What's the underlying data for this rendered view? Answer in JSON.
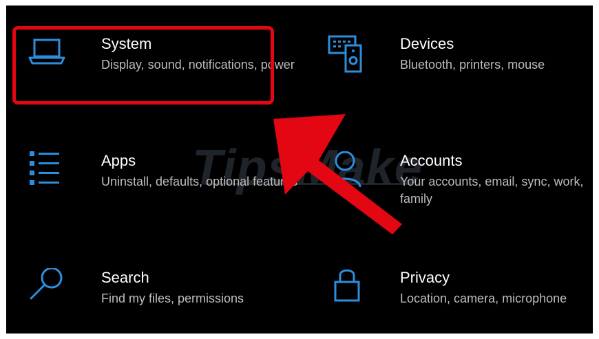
{
  "settings": {
    "tiles": [
      {
        "title": "System",
        "desc": "Display, sound, notifications, power",
        "icon": "laptop-icon"
      },
      {
        "title": "Devices",
        "desc": "Bluetooth, printers, mouse",
        "icon": "devices-icon"
      },
      {
        "title": "Apps",
        "desc": "Uninstall, defaults, optional features",
        "icon": "apps-list-icon"
      },
      {
        "title": "Accounts",
        "desc": "Your accounts, email, sync, work, family",
        "icon": "person-icon"
      },
      {
        "title": "Search",
        "desc": "Find my files, permissions",
        "icon": "search-icon"
      },
      {
        "title": "Privacy",
        "desc": "Location, camera, microphone",
        "icon": "lock-icon"
      }
    ]
  },
  "watermark": {
    "text": "TipsMake"
  },
  "colors": {
    "accent": "#2b8fe0",
    "highlight": "#e30613",
    "background": "#000000",
    "title": "#ffffff",
    "desc": "#bdbdbd"
  }
}
